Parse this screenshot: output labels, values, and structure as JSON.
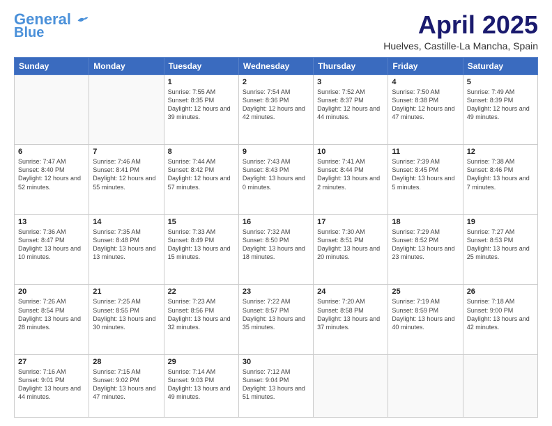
{
  "header": {
    "logo_line1": "General",
    "logo_line2": "Blue",
    "month": "April 2025",
    "location": "Huelves, Castille-La Mancha, Spain"
  },
  "weekdays": [
    "Sunday",
    "Monday",
    "Tuesday",
    "Wednesday",
    "Thursday",
    "Friday",
    "Saturday"
  ],
  "weeks": [
    [
      {
        "day": "",
        "info": ""
      },
      {
        "day": "",
        "info": ""
      },
      {
        "day": "1",
        "info": "Sunrise: 7:55 AM\nSunset: 8:35 PM\nDaylight: 12 hours and 39 minutes."
      },
      {
        "day": "2",
        "info": "Sunrise: 7:54 AM\nSunset: 8:36 PM\nDaylight: 12 hours and 42 minutes."
      },
      {
        "day": "3",
        "info": "Sunrise: 7:52 AM\nSunset: 8:37 PM\nDaylight: 12 hours and 44 minutes."
      },
      {
        "day": "4",
        "info": "Sunrise: 7:50 AM\nSunset: 8:38 PM\nDaylight: 12 hours and 47 minutes."
      },
      {
        "day": "5",
        "info": "Sunrise: 7:49 AM\nSunset: 8:39 PM\nDaylight: 12 hours and 49 minutes."
      }
    ],
    [
      {
        "day": "6",
        "info": "Sunrise: 7:47 AM\nSunset: 8:40 PM\nDaylight: 12 hours and 52 minutes."
      },
      {
        "day": "7",
        "info": "Sunrise: 7:46 AM\nSunset: 8:41 PM\nDaylight: 12 hours and 55 minutes."
      },
      {
        "day": "8",
        "info": "Sunrise: 7:44 AM\nSunset: 8:42 PM\nDaylight: 12 hours and 57 minutes."
      },
      {
        "day": "9",
        "info": "Sunrise: 7:43 AM\nSunset: 8:43 PM\nDaylight: 13 hours and 0 minutes."
      },
      {
        "day": "10",
        "info": "Sunrise: 7:41 AM\nSunset: 8:44 PM\nDaylight: 13 hours and 2 minutes."
      },
      {
        "day": "11",
        "info": "Sunrise: 7:39 AM\nSunset: 8:45 PM\nDaylight: 13 hours and 5 minutes."
      },
      {
        "day": "12",
        "info": "Sunrise: 7:38 AM\nSunset: 8:46 PM\nDaylight: 13 hours and 7 minutes."
      }
    ],
    [
      {
        "day": "13",
        "info": "Sunrise: 7:36 AM\nSunset: 8:47 PM\nDaylight: 13 hours and 10 minutes."
      },
      {
        "day": "14",
        "info": "Sunrise: 7:35 AM\nSunset: 8:48 PM\nDaylight: 13 hours and 13 minutes."
      },
      {
        "day": "15",
        "info": "Sunrise: 7:33 AM\nSunset: 8:49 PM\nDaylight: 13 hours and 15 minutes."
      },
      {
        "day": "16",
        "info": "Sunrise: 7:32 AM\nSunset: 8:50 PM\nDaylight: 13 hours and 18 minutes."
      },
      {
        "day": "17",
        "info": "Sunrise: 7:30 AM\nSunset: 8:51 PM\nDaylight: 13 hours and 20 minutes."
      },
      {
        "day": "18",
        "info": "Sunrise: 7:29 AM\nSunset: 8:52 PM\nDaylight: 13 hours and 23 minutes."
      },
      {
        "day": "19",
        "info": "Sunrise: 7:27 AM\nSunset: 8:53 PM\nDaylight: 13 hours and 25 minutes."
      }
    ],
    [
      {
        "day": "20",
        "info": "Sunrise: 7:26 AM\nSunset: 8:54 PM\nDaylight: 13 hours and 28 minutes."
      },
      {
        "day": "21",
        "info": "Sunrise: 7:25 AM\nSunset: 8:55 PM\nDaylight: 13 hours and 30 minutes."
      },
      {
        "day": "22",
        "info": "Sunrise: 7:23 AM\nSunset: 8:56 PM\nDaylight: 13 hours and 32 minutes."
      },
      {
        "day": "23",
        "info": "Sunrise: 7:22 AM\nSunset: 8:57 PM\nDaylight: 13 hours and 35 minutes."
      },
      {
        "day": "24",
        "info": "Sunrise: 7:20 AM\nSunset: 8:58 PM\nDaylight: 13 hours and 37 minutes."
      },
      {
        "day": "25",
        "info": "Sunrise: 7:19 AM\nSunset: 8:59 PM\nDaylight: 13 hours and 40 minutes."
      },
      {
        "day": "26",
        "info": "Sunrise: 7:18 AM\nSunset: 9:00 PM\nDaylight: 13 hours and 42 minutes."
      }
    ],
    [
      {
        "day": "27",
        "info": "Sunrise: 7:16 AM\nSunset: 9:01 PM\nDaylight: 13 hours and 44 minutes."
      },
      {
        "day": "28",
        "info": "Sunrise: 7:15 AM\nSunset: 9:02 PM\nDaylight: 13 hours and 47 minutes."
      },
      {
        "day": "29",
        "info": "Sunrise: 7:14 AM\nSunset: 9:03 PM\nDaylight: 13 hours and 49 minutes."
      },
      {
        "day": "30",
        "info": "Sunrise: 7:12 AM\nSunset: 9:04 PM\nDaylight: 13 hours and 51 minutes."
      },
      {
        "day": "",
        "info": ""
      },
      {
        "day": "",
        "info": ""
      },
      {
        "day": "",
        "info": ""
      }
    ]
  ]
}
